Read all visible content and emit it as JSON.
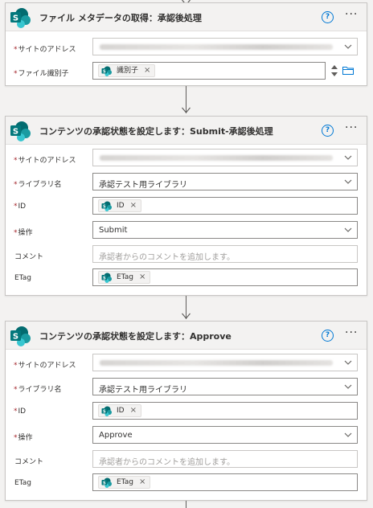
{
  "colors": {
    "accent": "#0078d4",
    "required": "#a4262c",
    "sharepoint": "#038387"
  },
  "cards": [
    {
      "title": "ファイル メタデータの取得：承認後処理",
      "help": "?",
      "more": "···",
      "fields": [
        {
          "required": "*",
          "label": "サイトのアドレス",
          "kind": "blurred-dropdown"
        },
        {
          "required": "*",
          "label": "ファイル識別子",
          "kind": "token",
          "token": "識別子",
          "token_x": "×"
        }
      ]
    },
    {
      "title": "コンテンツの承認状態を設定します：Submit-承認後処理",
      "help": "?",
      "more": "···",
      "fields": [
        {
          "required": "*",
          "label": "サイトのアドレス",
          "kind": "blurred-dropdown"
        },
        {
          "required": "*",
          "label": "ライブラリ名",
          "kind": "dropdown",
          "value": "承認テスト用ライブラリ"
        },
        {
          "required": "*",
          "label": "ID",
          "kind": "token",
          "token": "ID",
          "token_x": "×"
        },
        {
          "required": "*",
          "label": "操作",
          "kind": "dropdown",
          "value": "Submit"
        },
        {
          "required": "",
          "label": "コメント",
          "kind": "text",
          "placeholder": "承認者からのコメントを追加します。"
        },
        {
          "required": "",
          "label": "ETag",
          "kind": "token",
          "token": "ETag",
          "token_x": "×"
        }
      ]
    },
    {
      "title": "コンテンツの承認状態を設定します：Approve",
      "help": "?",
      "more": "···",
      "fields": [
        {
          "required": "*",
          "label": "サイトのアドレス",
          "kind": "blurred-dropdown"
        },
        {
          "required": "*",
          "label": "ライブラリ名",
          "kind": "dropdown",
          "value": "承認テスト用ライブラリ"
        },
        {
          "required": "*",
          "label": "ID",
          "kind": "token",
          "token": "ID",
          "token_x": "×"
        },
        {
          "required": "*",
          "label": "操作",
          "kind": "dropdown",
          "value": "Approve"
        },
        {
          "required": "",
          "label": "コメント",
          "kind": "text",
          "placeholder": "承認者からのコメントを追加します。"
        },
        {
          "required": "",
          "label": "ETag",
          "kind": "token",
          "token": "ETag",
          "token_x": "×"
        }
      ]
    }
  ]
}
